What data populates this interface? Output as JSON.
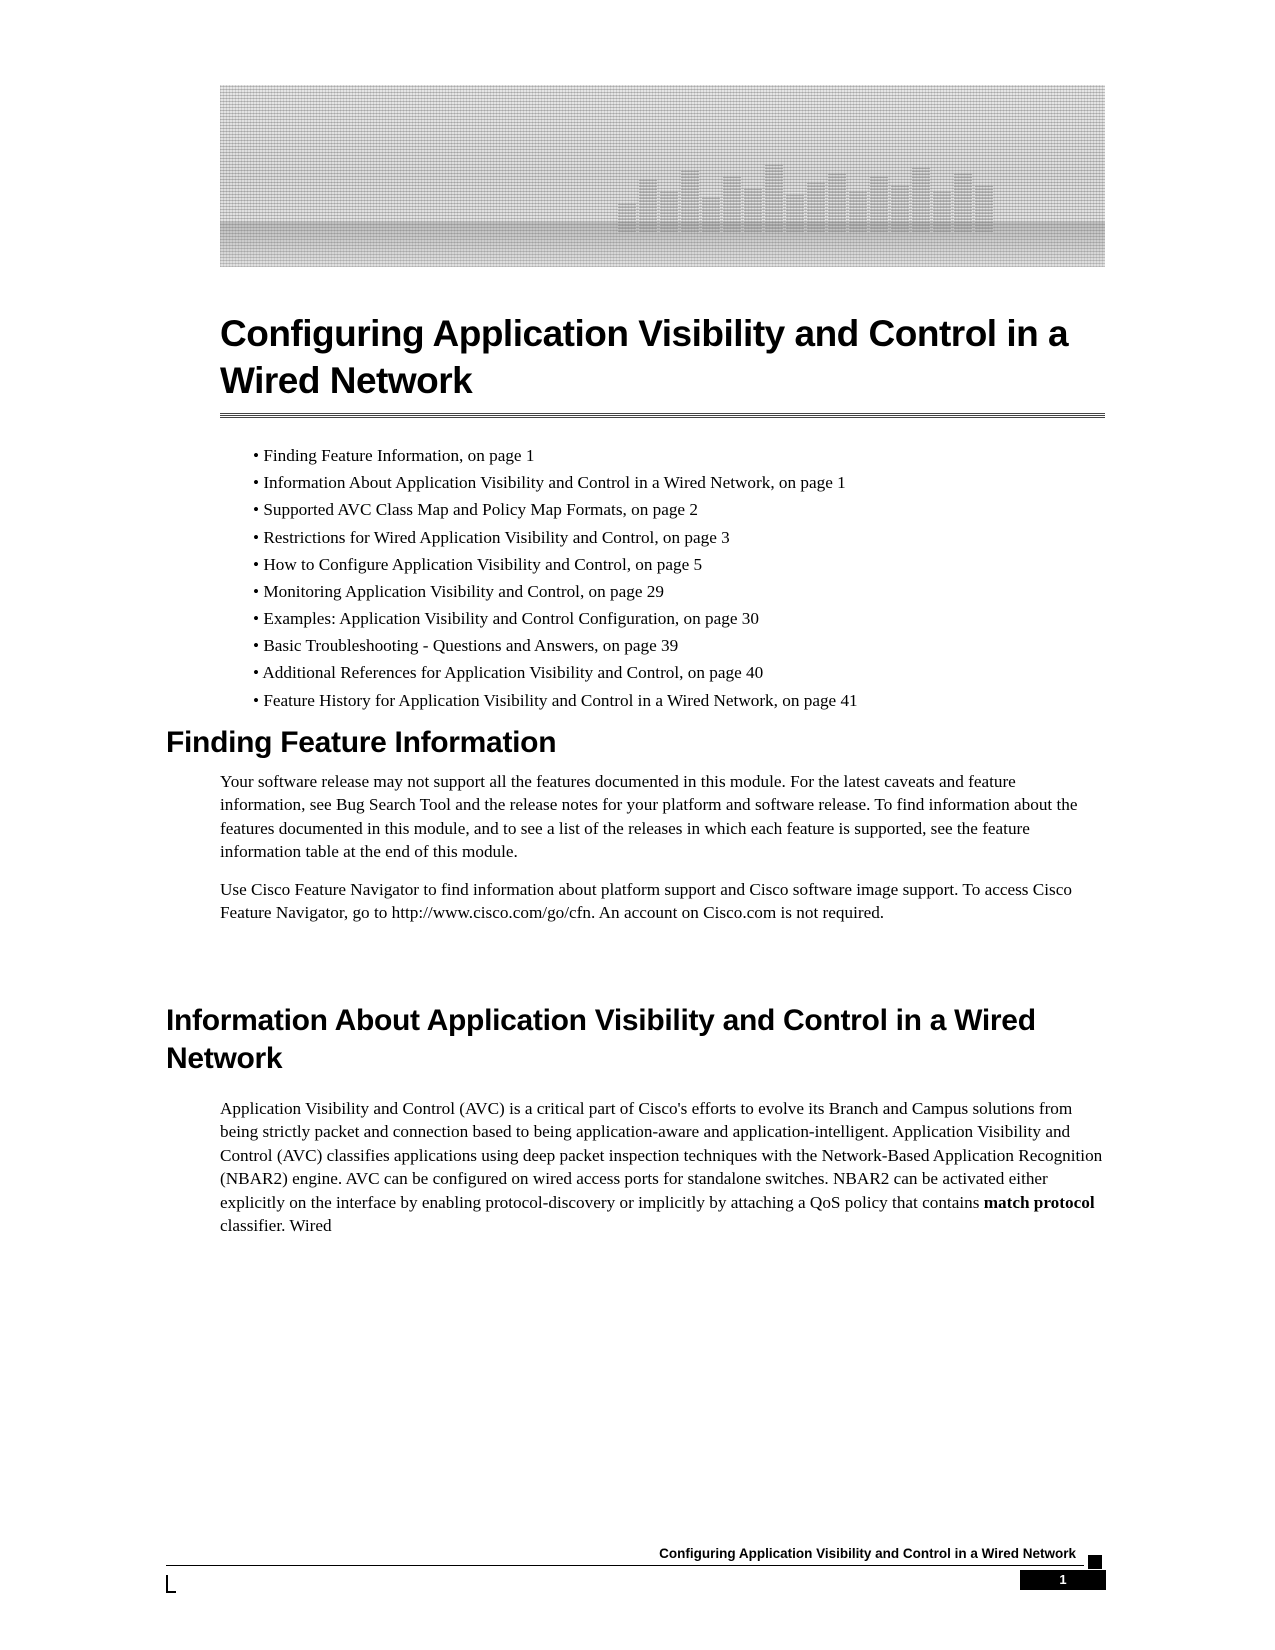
{
  "chapter_title": "Configuring Application Visibility and Control in a Wired Network",
  "toc": [
    "Finding Feature Information, on page 1",
    "Information About Application Visibility and Control in a Wired Network, on page 1",
    "Supported AVC Class Map and Policy Map Formats, on page 2",
    "Restrictions for Wired Application Visibility and Control, on page 3",
    "How to Configure Application Visibility and Control, on page 5",
    "Monitoring Application Visibility and Control, on page 29",
    "Examples: Application Visibility and Control Configuration, on page 30",
    "Basic Troubleshooting - Questions and Answers, on page 39",
    "Additional References for Application Visibility and Control, on page 40",
    "Feature History for Application Visibility and Control in a Wired Network, on page 41"
  ],
  "sec1": {
    "heading": "Finding Feature Information",
    "p1": "Your software release may not support all the features documented in this module. For the latest caveats and feature information, see Bug Search Tool and the release notes for your platform and software release. To find information about the features documented in this module, and to see a list of the releases in which each feature is supported, see the feature information table at the end of this module.",
    "p2_a": "Use Cisco Feature Navigator to find information about platform support and Cisco software image support. To access Cisco Feature Navigator, go to ",
    "p2_link": "http://www.cisco.com/go/cfn",
    "p2_b": ". An account on Cisco.com is not required."
  },
  "sec2": {
    "heading": "Information About Application Visibility and Control in a Wired Network",
    "p1_a": "Application Visibility and Control (AVC) is a critical part of Cisco's efforts to evolve its Branch and Campus solutions from being strictly packet and connection based to being application-aware and application-intelligent. Application Visibility and Control (AVC) classifies applications using deep packet inspection techniques with the Network-Based Application Recognition (NBAR2) engine. AVC can be configured on wired access ports for standalone switches. NBAR2 can be activated either explicitly on the interface by enabling protocol-discovery or implicitly by attaching a QoS policy that contains ",
    "p1_bold": "match protocol",
    "p1_b": " classifier. Wired"
  },
  "footer": {
    "title": "Configuring Application Visibility and Control in a Wired Network",
    "page": "1"
  }
}
